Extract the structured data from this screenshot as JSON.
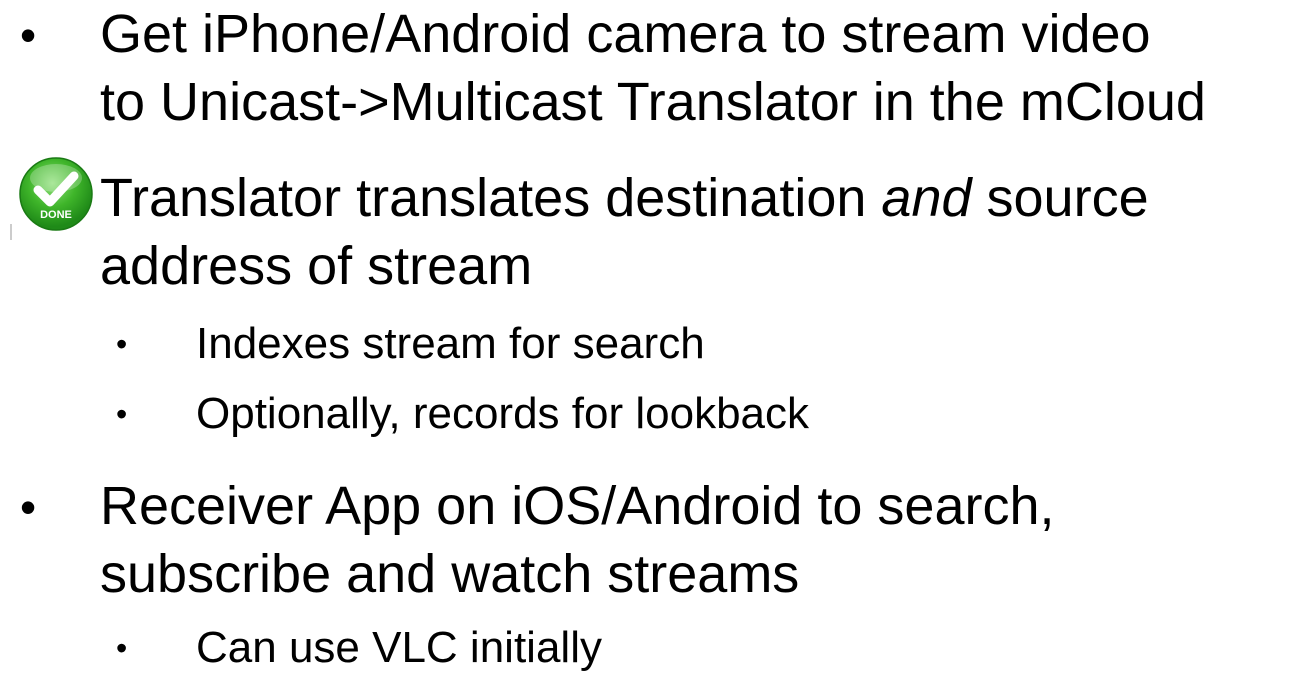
{
  "items": [
    {
      "bullet": "•",
      "lines": [
        "Get iPhone/Android camera to stream video",
        "to Unicast->Multicast Translator in the mCloud"
      ]
    },
    {
      "icon": "done-check-icon",
      "icon_label": "DONE",
      "line1_before": "Translator translates destination ",
      "line1_italic": "and",
      "line1_after": " source",
      "line2": "address of stream",
      "subitems": [
        {
          "bullet": "•",
          "text": "Indexes stream for search"
        },
        {
          "bullet": "•",
          "text": "Optionally, records for lookback"
        }
      ]
    },
    {
      "bullet": "•",
      "lines": [
        "Receiver App on iOS/Android to search,",
        "subscribe and watch streams"
      ],
      "subitems": [
        {
          "bullet": "•",
          "text": "Can use VLC initially"
        }
      ]
    }
  ],
  "colors": {
    "text": "#000000",
    "background": "#ffffff",
    "done_green": "#3fb52a",
    "done_green_dark": "#1f8a18"
  }
}
